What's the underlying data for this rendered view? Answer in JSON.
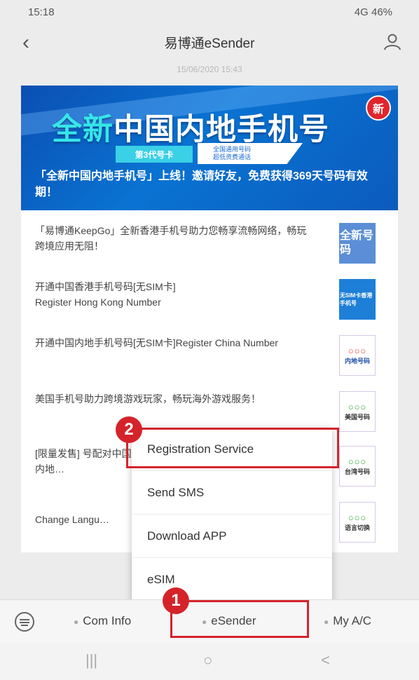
{
  "status_bar": {
    "time": "15:18",
    "right": "4G 46%"
  },
  "header": {
    "title": "易博通eSender"
  },
  "timestamp": "15/06/2020 15:43",
  "banner": {
    "title_highlight": "全新",
    "title_rest": "中国内地手机号",
    "badge": "新",
    "pill": "第3代号卡",
    "note_line1": "全国通用号码",
    "note_line2": "超低资费通话",
    "caption": "「全新中国内地手机号」上线！邀请好友，免费获得369天号码有效期！"
  },
  "list_items": [
    {
      "text": "「易博通KeepGo」全新香港手机号助力您畅享流畅网络，畅玩跨境应用无阻！",
      "thumb": "全新号码"
    },
    {
      "text": "开通中国香港手机号码[无SIM卡]\nRegister Hong Kong Number",
      "thumb": "无SIM卡香港手机号"
    },
    {
      "text": "开通中国内地手机号码[无SIM卡]Register China Number",
      "thumb_dots": "○○○",
      "thumb": "内地号码"
    },
    {
      "text": "美国手机号助力跨境游戏玩家，畅玩海外游戏服务！",
      "thumb_dots": "○○○",
      "thumb": "美国号码"
    },
    {
      "text": "[限量发售] 号配对中国内地…",
      "thumb_dots": "○○○",
      "thumb": "台湾号码"
    },
    {
      "text": "Change Langu…",
      "thumb_dots": "○○○",
      "thumb": "语言切换"
    }
  ],
  "popup_menu": {
    "items": [
      "Registration Service",
      "Send SMS",
      "Download APP",
      "eSIM"
    ]
  },
  "annotations": {
    "one": "1",
    "two": "2"
  },
  "bottom_menu": {
    "tabs": [
      "Com Info",
      "eSender",
      "My A/C"
    ]
  },
  "nav": {
    "recent": "|||",
    "home": "○",
    "back": "<"
  }
}
